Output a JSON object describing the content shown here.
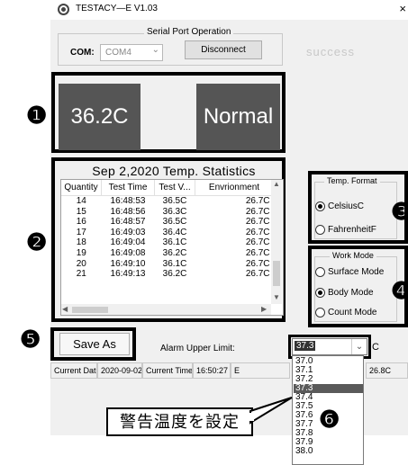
{
  "window": {
    "title": "TESTACY—E   V1.03",
    "close": "×"
  },
  "serial": {
    "legend": "Serial Port Operation",
    "com_label": "COM:",
    "com_value": "COM4",
    "disconnect": "Disconnect",
    "status": "success"
  },
  "display": {
    "temperature": "36.2C",
    "status": "Normal"
  },
  "markers": {
    "m1": "❶",
    "m2": "❷",
    "m3": "❸",
    "m4": "❹",
    "m5": "❺",
    "m6": "❻"
  },
  "stats": {
    "title": "Sep 2,2020  Temp. Statistics",
    "columns": [
      "Quantity",
      "Test Time",
      "Test V...",
      "Envrionment"
    ],
    "rows": [
      [
        "14",
        "16:48:53",
        "36.5C",
        "26.7C"
      ],
      [
        "15",
        "16:48:56",
        "36.3C",
        "26.7C"
      ],
      [
        "16",
        "16:48:57",
        "36.5C",
        "26.7C"
      ],
      [
        "17",
        "16:49:03",
        "36.4C",
        "26.7C"
      ],
      [
        "18",
        "16:49:04",
        "36.1C",
        "26.7C"
      ],
      [
        "19",
        "16:49:08",
        "36.2C",
        "26.7C"
      ],
      [
        "20",
        "16:49:10",
        "36.1C",
        "26.7C"
      ],
      [
        "21",
        "16:49:13",
        "36.2C",
        "26.7C"
      ]
    ]
  },
  "temp_format": {
    "legend": "Temp. Format",
    "options": [
      "CelsiusC",
      "FahrenheitF"
    ],
    "selected": 0
  },
  "work_mode": {
    "legend": "Work Mode",
    "options": [
      "Surface Mode",
      "Body Mode",
      "Count Mode"
    ],
    "selected": 1
  },
  "actions": {
    "save_as": "Save As"
  },
  "alarm": {
    "label": "Alarm Upper Limit:",
    "value": "37.3",
    "unit": "C",
    "options": [
      "37.0",
      "37.1",
      "37.2",
      "37.3",
      "37.4",
      "37.5",
      "37.6",
      "37.7",
      "37.8",
      "37.9",
      "38.0"
    ],
    "selected_index": 3
  },
  "statusbar": {
    "date_label": "Current Date：",
    "date": "2020-09-02",
    "time_label": "Current Time：",
    "time": "16:50:27",
    "extra": "E",
    "env_temp": "26.8C"
  },
  "callout": {
    "text": "警告温度を設定"
  },
  "icons": {
    "app": "app-logo-icon",
    "close": "close-icon",
    "dropdown": "chevron-down-icon"
  }
}
